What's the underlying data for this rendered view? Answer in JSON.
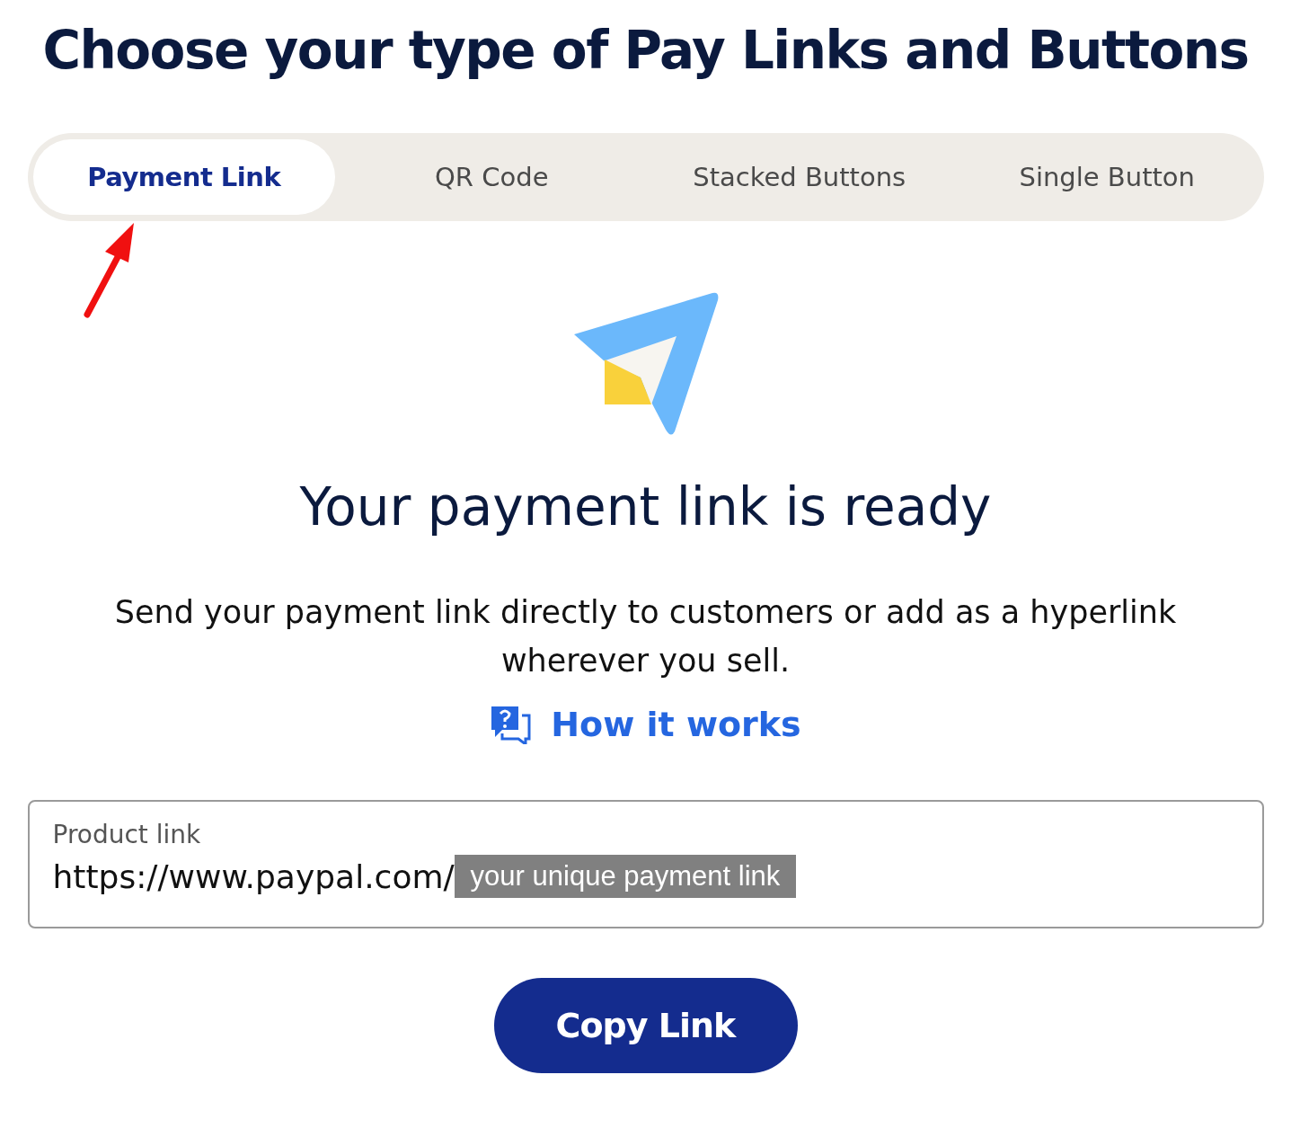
{
  "title": "Choose your type of Pay Links and Buttons",
  "tabs": [
    {
      "label": "Payment Link",
      "selected": true
    },
    {
      "label": "QR Code",
      "selected": false
    },
    {
      "label": "Stacked Buttons",
      "selected": false
    },
    {
      "label": "Single Button",
      "selected": false
    }
  ],
  "heading": "Your payment link is ready",
  "description": "Send your payment link directly to customers or add as a hyperlink wherever you sell.",
  "help_link": {
    "label": "How it works"
  },
  "product_link": {
    "label": "Product link",
    "value": "https://www.paypal.com/",
    "overlay_label": "your unique payment link"
  },
  "copy_button": {
    "label": "Copy Link"
  }
}
